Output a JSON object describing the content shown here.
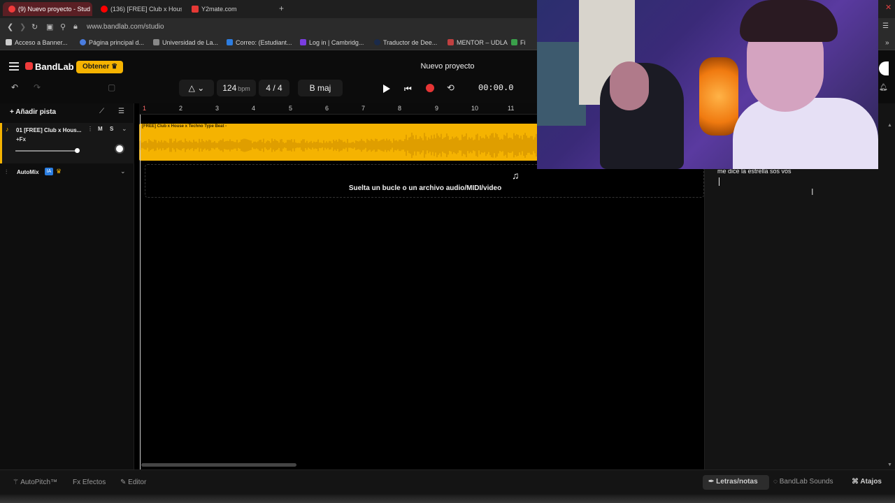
{
  "browser": {
    "tabs": [
      {
        "label": "(9) Nuevo proyecto - Stud",
        "active": true
      },
      {
        "label": "(136) [FREE] Club x House",
        "active": false
      },
      {
        "label": "Y2mate.com",
        "active": false
      }
    ],
    "url": "www.bandlab.com/studio",
    "bookmarks": [
      "Acceso a Banner...",
      "Página principal d...",
      "Universidad de La...",
      "Correo: (Estudiant...",
      "Log in | Cambridg...",
      "Traductor de Dee...",
      "MENTOR – UDLA",
      "Fi"
    ]
  },
  "header": {
    "logo": "BandLab",
    "obtener": "Obtener",
    "project_title": "Nuevo proyecto",
    "bpm": "124",
    "bpm_unit": "bpm",
    "time_signature": "4 / 4",
    "key": "B maj",
    "time": "00:00.0"
  },
  "sidebar": {
    "add_track": "Añadir pista",
    "track": {
      "name": "01 [FREE] Club x Hous...",
      "mute": "M",
      "solo": "S",
      "fx": "+Fx",
      "volume": 0.85
    },
    "automix": "AutoMix",
    "ia_badge": "IA"
  },
  "timeline": {
    "ruler": [
      "1",
      "2",
      "3",
      "4",
      "5",
      "6",
      "7",
      "8",
      "9",
      "10",
      "11"
    ],
    "clip_title": "[FREE] Club x House x Techno Type Beat -",
    "drop_text": "Suelta un bucle o un archivo audio/MIDI/video"
  },
  "lyrics": {
    "text": "me dice la estrella sos vos"
  },
  "bottom": {
    "autopitch": "AutoPitch™",
    "efectos": "Efectos",
    "editor": "Editor",
    "letras": "Letras/notas",
    "sounds": "BandLab Sounds",
    "atajos": "Atajos"
  },
  "colors": {
    "accent": "#f5b301",
    "record": "#e63535",
    "brand": "#ef3b3b"
  }
}
